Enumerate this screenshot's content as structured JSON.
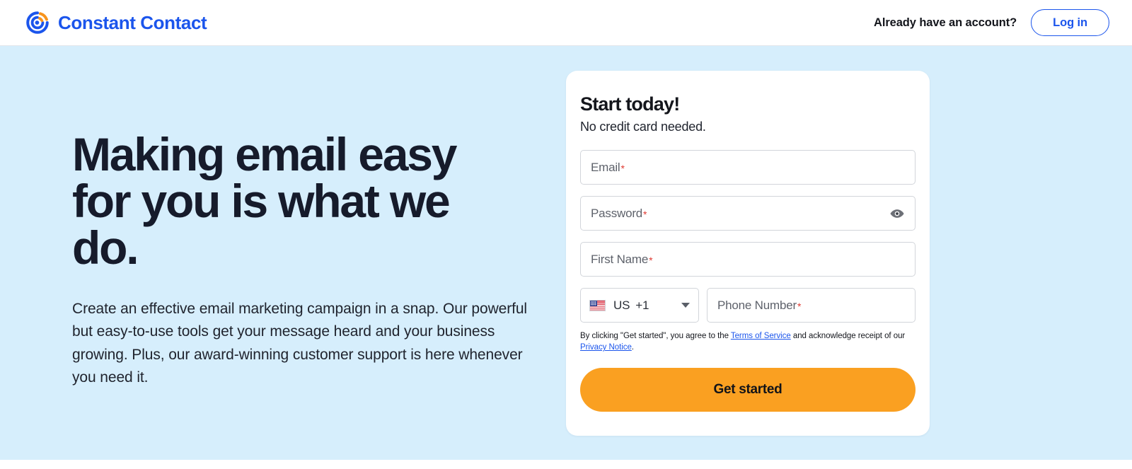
{
  "header": {
    "logo_icon": "constant-contact-logo-icon",
    "brand_name": "Constant Contact",
    "account_prompt": "Already have an account?",
    "login_label": "Log in",
    "brand_color": "#1b55ec",
    "accent_orange": "#f7941d"
  },
  "hero": {
    "headline": "Making email easy for you is what we do.",
    "subcopy": "Create an effective email marketing campaign in a snap. Our powerful but easy-to-use tools get your message heard and your business growing. Plus, our award-winning customer support is here whenever you need it.",
    "background_color": "#d6eefc"
  },
  "signup": {
    "title": "Start today!",
    "subtitle": "No credit card needed.",
    "required_marker": "*",
    "required_color": "#e03a32",
    "fields": {
      "email": {
        "label": "Email",
        "placeholder": "Email",
        "value": ""
      },
      "password": {
        "label": "Password",
        "placeholder": "Password",
        "value": "",
        "toggle_icon": "eye-icon"
      },
      "first_name": {
        "label": "First Name",
        "placeholder": "First Name",
        "value": ""
      },
      "phone": {
        "label": "Phone Number",
        "placeholder": "Phone Number",
        "value": ""
      }
    },
    "country": {
      "flag_icon": "us-flag-icon",
      "code": "US",
      "dial_code": "+1",
      "caret_icon": "chevron-down-icon"
    },
    "legal": {
      "prefix": "By clicking \"Get started\", you agree to the ",
      "terms_link": "Terms of Service",
      "middle": " and acknowledge receipt of our ",
      "privacy_link": "Privacy Notice",
      "suffix": "."
    },
    "cta_label": "Get started",
    "cta_color": "#faa021"
  }
}
